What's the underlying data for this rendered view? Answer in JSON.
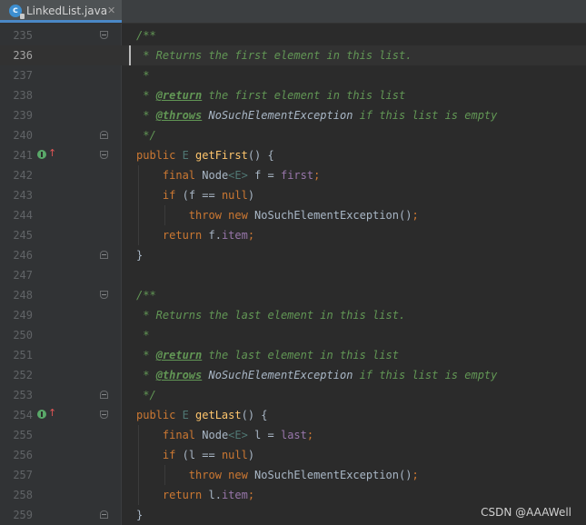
{
  "tab": {
    "file_name": "LinkedList.java",
    "icon_letter": "c",
    "close_glyph": "✕"
  },
  "lines": [
    {
      "n": "235",
      "tokens": [
        [
          "doc",
          "/**"
        ]
      ],
      "fold": "top"
    },
    {
      "n": "236",
      "tokens": [
        [
          "doc",
          " * Returns the first element in this list."
        ]
      ],
      "current": true
    },
    {
      "n": "237",
      "tokens": [
        [
          "doc",
          " *"
        ]
      ]
    },
    {
      "n": "238",
      "tokens": [
        [
          "doc",
          " * "
        ],
        [
          "tag",
          "@return"
        ],
        [
          "doc",
          " the first element in this list"
        ]
      ]
    },
    {
      "n": "239",
      "tokens": [
        [
          "doc",
          " * "
        ],
        [
          "tag",
          "@throws"
        ],
        [
          "ref",
          " NoSuchElementException"
        ],
        [
          "doc",
          " if this list is empty"
        ]
      ]
    },
    {
      "n": "240",
      "tokens": [
        [
          "doc",
          " */"
        ]
      ],
      "fold": "bottom"
    },
    {
      "n": "241",
      "tokens": [
        [
          "kw",
          "public "
        ],
        [
          "type",
          "E "
        ],
        [
          "fn",
          "getFirst"
        ],
        [
          "plain",
          "() {"
        ]
      ],
      "fold": "top",
      "overrides": true
    },
    {
      "n": "242",
      "tokens": [
        [
          "plain",
          "    "
        ],
        [
          "kw",
          "final "
        ],
        [
          "plain",
          "Node"
        ],
        [
          "type",
          "<E>"
        ],
        [
          "plain",
          " f = "
        ],
        [
          "field",
          "first"
        ],
        [
          "kw",
          ";"
        ]
      ]
    },
    {
      "n": "243",
      "tokens": [
        [
          "plain",
          "    "
        ],
        [
          "kw",
          "if "
        ],
        [
          "plain",
          "(f == "
        ],
        [
          "kw",
          "null"
        ],
        [
          "plain",
          ")"
        ]
      ]
    },
    {
      "n": "244",
      "tokens": [
        [
          "plain",
          "        "
        ],
        [
          "kw",
          "throw new "
        ],
        [
          "plain",
          "NoSuchElementException()"
        ],
        [
          "kw",
          ";"
        ]
      ]
    },
    {
      "n": "245",
      "tokens": [
        [
          "plain",
          "    "
        ],
        [
          "kw",
          "return "
        ],
        [
          "plain",
          "f."
        ],
        [
          "field",
          "item"
        ],
        [
          "kw",
          ";"
        ]
      ]
    },
    {
      "n": "246",
      "tokens": [
        [
          "plain",
          "}"
        ]
      ],
      "fold": "bottom"
    },
    {
      "n": "247",
      "tokens": []
    },
    {
      "n": "248",
      "tokens": [
        [
          "doc",
          "/**"
        ]
      ],
      "fold": "top"
    },
    {
      "n": "249",
      "tokens": [
        [
          "doc",
          " * Returns the last element in this list."
        ]
      ]
    },
    {
      "n": "250",
      "tokens": [
        [
          "doc",
          " *"
        ]
      ]
    },
    {
      "n": "251",
      "tokens": [
        [
          "doc",
          " * "
        ],
        [
          "tag",
          "@return"
        ],
        [
          "doc",
          " the last element in this list"
        ]
      ]
    },
    {
      "n": "252",
      "tokens": [
        [
          "doc",
          " * "
        ],
        [
          "tag",
          "@throws"
        ],
        [
          "ref",
          " NoSuchElementException"
        ],
        [
          "doc",
          " if this list is empty"
        ]
      ]
    },
    {
      "n": "253",
      "tokens": [
        [
          "doc",
          " */"
        ]
      ],
      "fold": "bottom"
    },
    {
      "n": "254",
      "tokens": [
        [
          "kw",
          "public "
        ],
        [
          "type",
          "E "
        ],
        [
          "fn",
          "getLast"
        ],
        [
          "plain",
          "() {"
        ]
      ],
      "fold": "top",
      "overrides": true
    },
    {
      "n": "255",
      "tokens": [
        [
          "plain",
          "    "
        ],
        [
          "kw",
          "final "
        ],
        [
          "plain",
          "Node"
        ],
        [
          "type",
          "<E>"
        ],
        [
          "plain",
          " l = "
        ],
        [
          "field",
          "last"
        ],
        [
          "kw",
          ";"
        ]
      ]
    },
    {
      "n": "256",
      "tokens": [
        [
          "plain",
          "    "
        ],
        [
          "kw",
          "if "
        ],
        [
          "plain",
          "(l == "
        ],
        [
          "kw",
          "null"
        ],
        [
          "plain",
          ")"
        ]
      ]
    },
    {
      "n": "257",
      "tokens": [
        [
          "plain",
          "        "
        ],
        [
          "kw",
          "throw new "
        ],
        [
          "plain",
          "NoSuchElementException()"
        ],
        [
          "kw",
          ";"
        ]
      ]
    },
    {
      "n": "258",
      "tokens": [
        [
          "plain",
          "    "
        ],
        [
          "kw",
          "return "
        ],
        [
          "plain",
          "l."
        ],
        [
          "field",
          "item"
        ],
        [
          "kw",
          ";"
        ]
      ]
    },
    {
      "n": "259",
      "tokens": [
        [
          "plain",
          "}"
        ]
      ],
      "fold": "bottom"
    }
  ],
  "overrides_arrow": "↑",
  "watermark": "CSDN @AAAWell",
  "colors": {
    "background": "#2b2b2b",
    "gutter": "#313335",
    "keyword": "#cc7832",
    "doc_comment": "#629755",
    "method": "#ffc66d",
    "field": "#9876aa",
    "plain": "#a9b7c6"
  }
}
